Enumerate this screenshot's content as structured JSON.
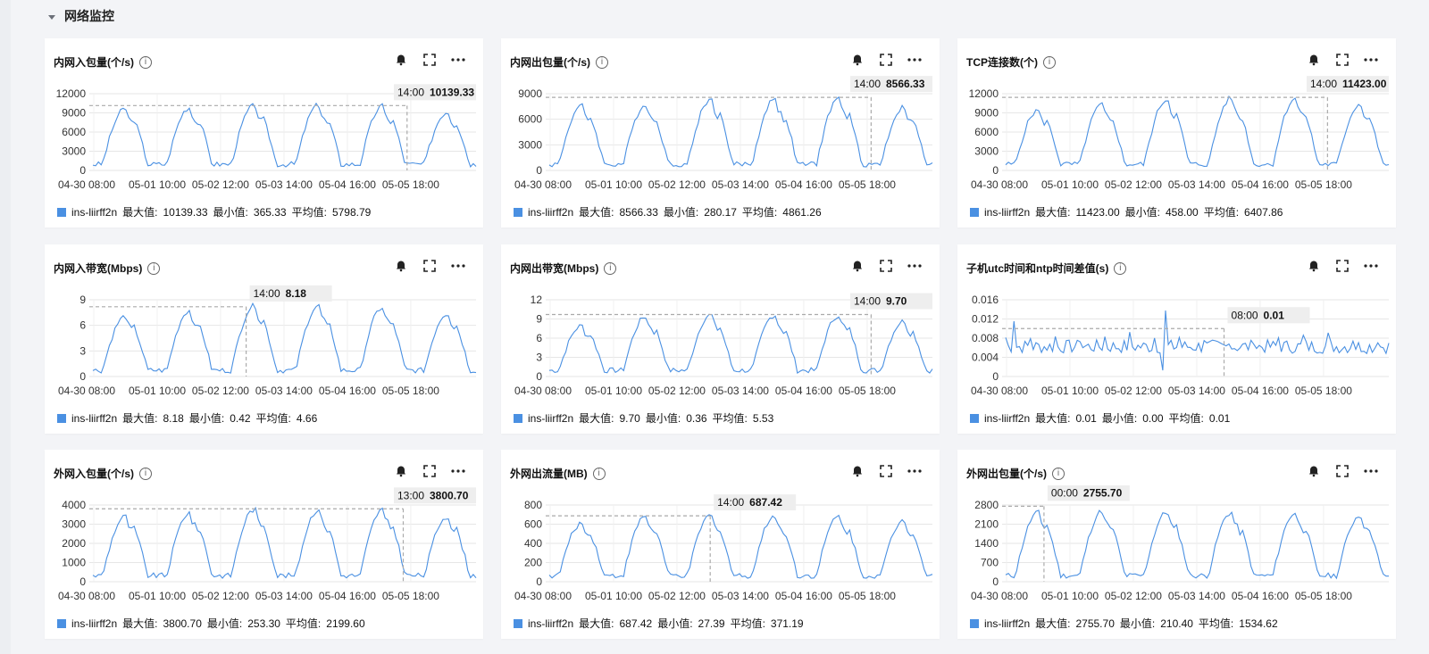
{
  "section": {
    "title": "网络监控"
  },
  "icons": {
    "bell": "bell-icon",
    "fullscreen": "fullscreen-icon",
    "more": "more-icon",
    "info": "info-icon"
  },
  "colors": {
    "line": "#4a90e2",
    "grid": "#e6e6e6",
    "tooltip_bg": "#eeeeee",
    "guide": "#aaaaaa"
  },
  "x_axis_labels": {
    "six": [
      "04-30 08:00",
      "05-01 10:00",
      "05-02 12:00",
      "05-03 14:00",
      "05-04 16:00",
      "05-05 18:00"
    ],
    "six_alt": [
      "04-30 08:00",
      "05-01 10:00",
      "05-02 12:00",
      "05-03 14:00",
      "05-04 16:00",
      "05-05 18:00"
    ]
  },
  "legend_labels": {
    "max": "最大值:",
    "min": "最小值:",
    "avg": "平均值:"
  },
  "cards": [
    {
      "title": "内网入包量(个/s)",
      "series_name": "ins-liirff2n",
      "yticks": [
        "12000",
        "9000",
        "6000",
        "3000",
        "0"
      ],
      "yvals": [
        12000,
        9000,
        6000,
        3000,
        0
      ],
      "tooltip_time": "14:00",
      "tooltip_value": "10139.33",
      "legend": {
        "max": "10139.33",
        "min": "365.33",
        "avg": "5798.79"
      }
    },
    {
      "title": "内网出包量(个/s)",
      "series_name": "ins-liirff2n",
      "yticks": [
        "9000",
        "6000",
        "3000",
        "0"
      ],
      "yvals": [
        9000,
        6000,
        3000,
        0
      ],
      "tooltip_time": "14:00",
      "tooltip_value": "8566.33",
      "legend": {
        "max": "8566.33",
        "min": "280.17",
        "avg": "4861.26"
      }
    },
    {
      "title": "TCP连接数(个)",
      "series_name": "ins-liirff2n",
      "yticks": [
        "12000",
        "9000",
        "6000",
        "3000",
        "0"
      ],
      "yvals": [
        12000,
        9000,
        6000,
        3000,
        0
      ],
      "tooltip_time": "14:00",
      "tooltip_value": "11423.00",
      "legend": {
        "max": "11423.00",
        "min": "458.00",
        "avg": "6407.86"
      }
    },
    {
      "title": "内网入带宽(Mbps)",
      "series_name": "ins-liirff2n",
      "yticks": [
        "9",
        "6",
        "3",
        "0"
      ],
      "yvals": [
        9,
        6,
        3,
        0
      ],
      "tooltip_time": "14:00",
      "tooltip_value": "8.18",
      "legend": {
        "max": "8.18",
        "min": "0.42",
        "avg": "4.66"
      }
    },
    {
      "title": "内网出带宽(Mbps)",
      "series_name": "ins-liirff2n",
      "yticks": [
        "12",
        "9",
        "6",
        "3",
        "0"
      ],
      "yvals": [
        12,
        9,
        6,
        3,
        0
      ],
      "tooltip_time": "14:00",
      "tooltip_value": "9.70",
      "legend": {
        "max": "9.70",
        "min": "0.36",
        "avg": "5.53"
      }
    },
    {
      "title": "子机utc时间和ntp时间差值(s)",
      "series_name": "ins-liirff2n",
      "yticks": [
        "0.016",
        "0.012",
        "0.008",
        "0.004",
        "0"
      ],
      "yvals": [
        0.016,
        0.012,
        0.008,
        0.004,
        0
      ],
      "tooltip_time": "08:00",
      "tooltip_value": "0.01",
      "legend": {
        "max": "0.01",
        "min": "0.00",
        "avg": "0.01"
      }
    },
    {
      "title": "外网入包量(个/s)",
      "series_name": "ins-liirff2n",
      "yticks": [
        "4000",
        "3000",
        "2000",
        "1000",
        "0"
      ],
      "yvals": [
        4000,
        3000,
        2000,
        1000,
        0
      ],
      "tooltip_time": "13:00",
      "tooltip_value": "3800.70",
      "legend": {
        "max": "3800.70",
        "min": "253.30",
        "avg": "2199.60"
      }
    },
    {
      "title": "外网出流量(MB)",
      "series_name": "ins-liirff2n",
      "yticks": [
        "800",
        "600",
        "400",
        "200",
        "0"
      ],
      "yvals": [
        800,
        600,
        400,
        200,
        0
      ],
      "tooltip_time": "14:00",
      "tooltip_value": "687.42",
      "legend": {
        "max": "687.42",
        "min": "27.39",
        "avg": "371.19"
      }
    },
    {
      "title": "外网出包量(个/s)",
      "series_name": "ins-liirff2n",
      "yticks": [
        "2800",
        "2100",
        "1400",
        "700",
        "0"
      ],
      "yvals": [
        2800,
        2100,
        1400,
        700,
        0
      ],
      "tooltip_time": "00:00",
      "tooltip_value": "2755.70",
      "legend": {
        "max": "2755.70",
        "min": "210.40",
        "avg": "1534.62"
      }
    }
  ],
  "chart_data": [
    {
      "type": "line",
      "title": "内网入包量(个/s)",
      "ylim": [
        0,
        12000
      ],
      "series": [
        {
          "name": "ins-liirff2n",
          "max": 10139.33,
          "min": 365.33,
          "avg": 5798.79
        }
      ],
      "tooltip": {
        "x": "05-04 14:00",
        "y": 10139.33
      }
    },
    {
      "type": "line",
      "title": "内网出包量(个/s)",
      "ylim": [
        0,
        9000
      ],
      "series": [
        {
          "name": "ins-liirff2n",
          "max": 8566.33,
          "min": 280.17,
          "avg": 4861.26
        }
      ],
      "tooltip": {
        "x": "05-04 14:00",
        "y": 8566.33
      }
    },
    {
      "type": "line",
      "title": "TCP连接数(个)",
      "ylim": [
        0,
        12000
      ],
      "series": [
        {
          "name": "ins-liirff2n",
          "max": 11423.0,
          "min": 458.0,
          "avg": 6407.86
        }
      ],
      "tooltip": {
        "x": "05-04 14:00",
        "y": 11423.0
      }
    },
    {
      "type": "line",
      "title": "内网入带宽(Mbps)",
      "ylim": [
        0,
        9
      ],
      "series": [
        {
          "name": "ins-liirff2n",
          "max": 8.18,
          "min": 0.42,
          "avg": 4.66
        }
      ],
      "tooltip": {
        "x": "05-02 14:00",
        "y": 8.18
      }
    },
    {
      "type": "line",
      "title": "内网出带宽(Mbps)",
      "ylim": [
        0,
        12
      ],
      "series": [
        {
          "name": "ins-liirff2n",
          "max": 9.7,
          "min": 0.36,
          "avg": 5.53
        }
      ],
      "tooltip": {
        "x": "05-04 14:00",
        "y": 9.7
      }
    },
    {
      "type": "line",
      "title": "子机utc时间和ntp时间差值(s)",
      "ylim": [
        0,
        0.016
      ],
      "series": [
        {
          "name": "ins-liirff2n",
          "max": 0.01,
          "min": 0.0,
          "avg": 0.01
        }
      ],
      "tooltip": {
        "x": "05-03 08:00",
        "y": 0.01
      }
    },
    {
      "type": "line",
      "title": "外网入包量(个/s)",
      "ylim": [
        0,
        4000
      ],
      "series": [
        {
          "name": "ins-liirff2n",
          "max": 3800.7,
          "min": 253.3,
          "avg": 2199.6
        }
      ],
      "tooltip": {
        "x": "05-04 13:00",
        "y": 3800.7
      }
    },
    {
      "type": "line",
      "title": "外网出流量(MB)",
      "ylim": [
        0,
        800
      ],
      "series": [
        {
          "name": "ins-liirff2n",
          "max": 687.42,
          "min": 27.39,
          "avg": 371.19
        }
      ],
      "tooltip": {
        "x": "05-02 14:00",
        "y": 687.42
      }
    },
    {
      "type": "line",
      "title": "外网出包量(个/s)",
      "ylim": [
        0,
        2800
      ],
      "series": [
        {
          "name": "ins-liirff2n",
          "max": 2755.7,
          "min": 210.4,
          "avg": 1534.62
        }
      ],
      "tooltip": {
        "x": "05-01 00:00",
        "y": 2755.7
      }
    }
  ]
}
